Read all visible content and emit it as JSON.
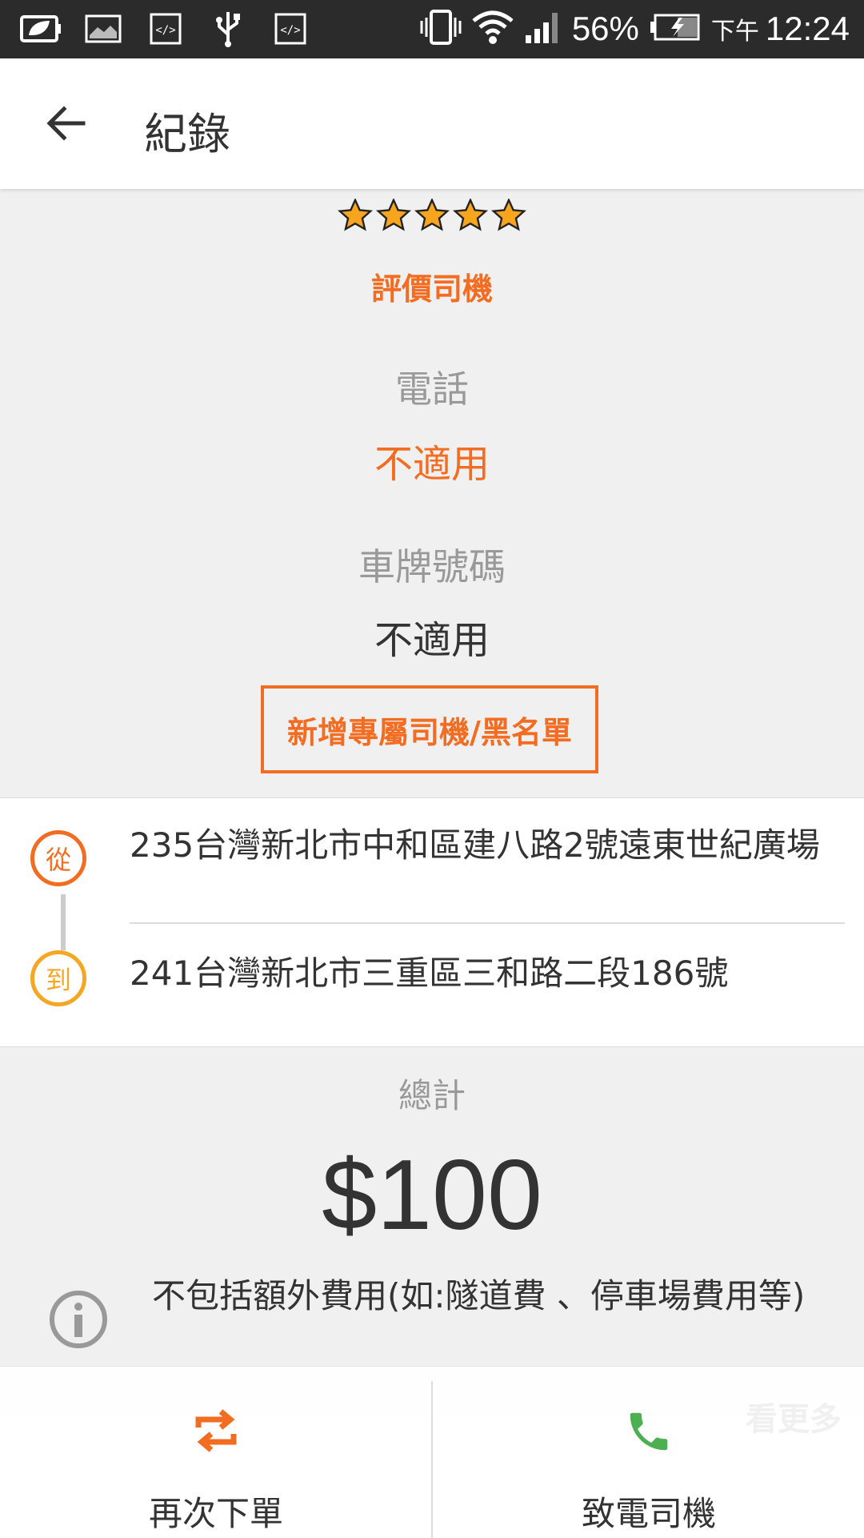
{
  "status_bar": {
    "icons": [
      "leaf-battery-icon",
      "image-icon",
      "code-icon",
      "usb-icon",
      "code-icon",
      "vibrate-icon",
      "wifi-icon",
      "signal-icon",
      "battery-charging-icon"
    ],
    "battery": "56%",
    "time_prefix": "下午",
    "time": "12:24"
  },
  "app_bar": {
    "title": "紀錄",
    "back_icon": "back-arrow-icon"
  },
  "driver": {
    "rating_stars": 5,
    "rate_label": "評價司機",
    "phone_label": "電話",
    "phone_value": "不適用",
    "plate_label": "車牌號碼",
    "plate_value": "不適用",
    "favorite_blacklist_button": "新增專屬司機/黑名單"
  },
  "route": {
    "from_badge": "從",
    "from_address": "235台灣新北市中和區建八路2號遠東世紀廣場",
    "to_badge": "到",
    "to_address": "241台灣新北市三重區三和路二段186號"
  },
  "fare": {
    "total_label": "總計",
    "total_amount": "$100",
    "note": "不包括額外費用(如:隧道費 、停車場費用等)"
  },
  "bottom_bar": {
    "reorder_label": "再次下單",
    "call_driver_label": "致電司機",
    "see_more": "看更多"
  },
  "colors": {
    "accent": "#f26d21",
    "to_badge": "#f5a623",
    "call_icon": "#4caf50"
  }
}
